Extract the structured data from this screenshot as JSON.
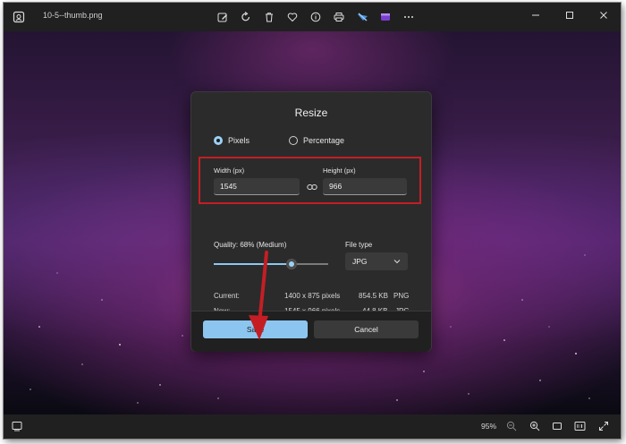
{
  "titlebar": {
    "filename": "10-5--thumb.png",
    "toolbar_icons": [
      "edit-icon",
      "rotate-icon",
      "delete-icon",
      "favorite-icon",
      "info-icon",
      "print-icon",
      "background-removal-icon",
      "clipchamp-icon",
      "more-icon"
    ],
    "window_controls": [
      "minimize-icon",
      "maximize-icon",
      "close-icon"
    ]
  },
  "dialog": {
    "title": "Resize",
    "mode_pixels": "Pixels",
    "mode_percentage": "Percentage",
    "selected_mode": "Pixels",
    "width_label": "Width  (px)",
    "width_value": "1545",
    "height_label": "Height  (px)",
    "height_value": "966",
    "quality_label": "Quality: 68% (Medium)",
    "quality_value": 68,
    "file_type_label": "File type",
    "file_type_value": "JPG",
    "current_label": "Current:",
    "current_dims": "1400 x 875 pixels",
    "current_size": "854.5 KB",
    "current_format": "PNG",
    "new_label": "New:",
    "new_dims": "1545 x 966 pixels",
    "new_size": "44.8 KB",
    "new_format": "JPG",
    "save_label": "Save",
    "cancel_label": "Cancel"
  },
  "statusbar": {
    "zoom": "95%"
  },
  "colors": {
    "accent": "#8cc6f0",
    "highlight_box": "#c41e24",
    "arrow": "#c41e24"
  }
}
